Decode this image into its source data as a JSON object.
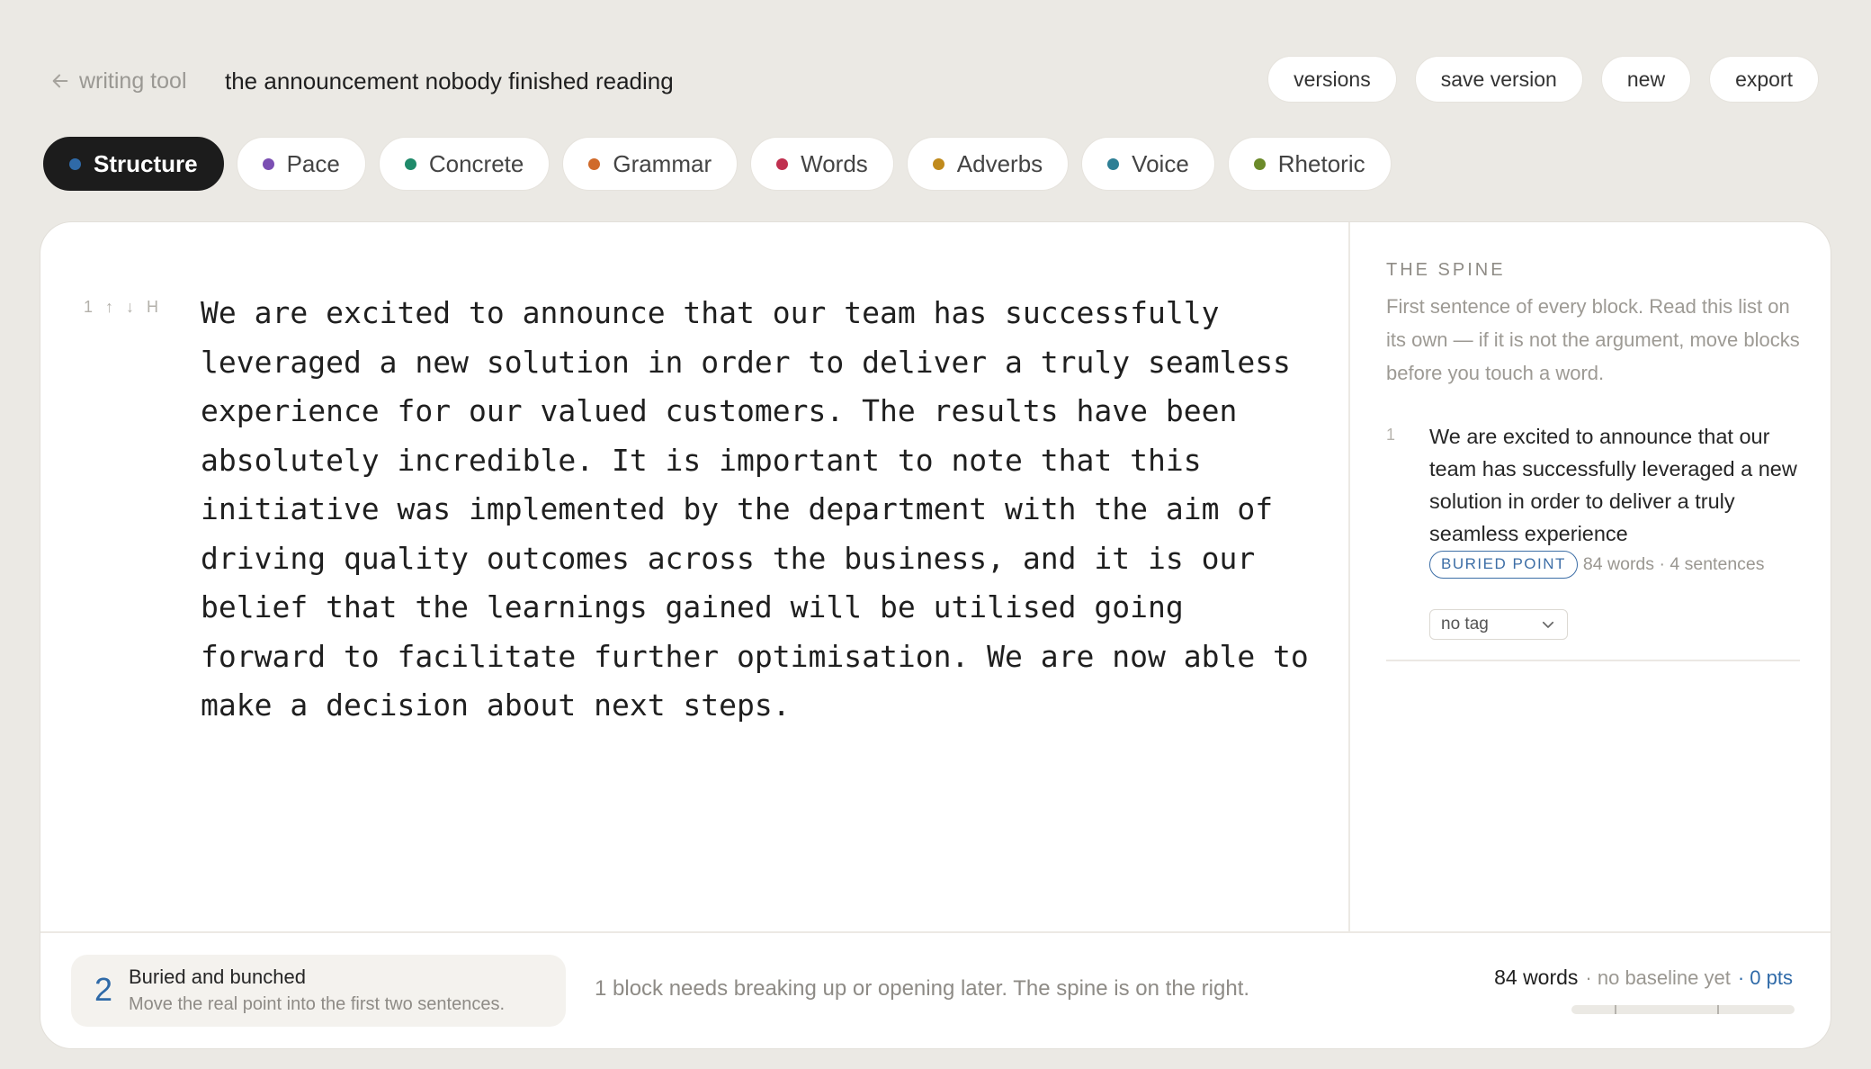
{
  "header": {
    "back_label": "writing tool",
    "doc_title": "the announcement nobody finished reading",
    "actions": [
      "versions",
      "save version",
      "new",
      "export"
    ]
  },
  "tabs": [
    {
      "label": "Structure",
      "color": "#2f6aa8",
      "active": true
    },
    {
      "label": "Pace",
      "color": "#7b4fb3",
      "active": false
    },
    {
      "label": "Concrete",
      "color": "#1f8a6a",
      "active": false
    },
    {
      "label": "Grammar",
      "color": "#d06a2a",
      "active": false
    },
    {
      "label": "Words",
      "color": "#c0304f",
      "active": false
    },
    {
      "label": "Adverbs",
      "color": "#c08a1c",
      "active": false
    },
    {
      "label": "Voice",
      "color": "#2e7f95",
      "active": false
    },
    {
      "label": "Rhetoric",
      "color": "#6b8a2a",
      "active": false
    }
  ],
  "editor": {
    "block_number": "1",
    "move_up": "↑",
    "move_down": "↓",
    "heading_toggle": "H",
    "text": "We are excited to announce that our team has successfully leveraged a new solution in order to deliver a truly seamless experience for our valued customers. The results have been absolutely incredible. It is important to note that this initiative was implemented by the department with the aim of driving quality outcomes across the business, and it is our belief that the learnings gained will be utilised going forward to facilitate further optimisation. We are now able to make a decision about next steps."
  },
  "spine": {
    "title": "THE SPINE",
    "description": "First sentence of every block. Read this list on its own — if it is not the argument, move blocks before you touch a word.",
    "items": [
      {
        "number": "1",
        "sentence": "We are excited to announce that our team has successfully leveraged a new solution in order to deliver a truly seamless experience",
        "badge": "BURIED POINT",
        "meta": "84 words · 4 sentences",
        "tag": "no tag"
      }
    ]
  },
  "footer": {
    "issue_count": "2",
    "issue_title": "Buried and bunched",
    "issue_sub": "Move the real point into the first two sentences.",
    "message": "1 block needs breaking up or opening later. The spine is on the right.",
    "word_count": "84 words",
    "baseline": "· no baseline yet",
    "points": "· 0 pts"
  },
  "colors": {
    "accent": "#2f6aa8",
    "background": "#ebe9e4",
    "active_tab": "#1c1c1c"
  }
}
